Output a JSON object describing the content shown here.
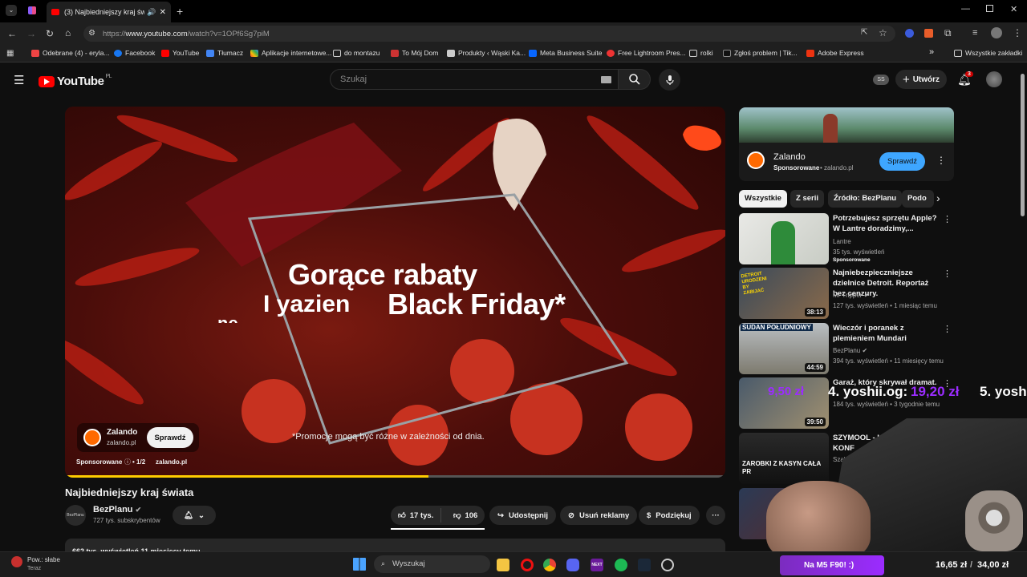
{
  "browser": {
    "tab_title": "(3) Najbiedniejszy kraj świat",
    "url_prefix": "https://",
    "url_domain": "www.youtube.com",
    "url_path": "/watch?v=1OPf6Sg7piM",
    "bookmarks": [
      "Odebrane (4) - eryla...",
      "Facebook",
      "YouTube",
      "Tłumacz",
      "Aplikacje internetowe...",
      "do montazu",
      "To Mój Dom",
      "Produkty ‹ Wąski Ka...",
      "Meta Business Suite",
      "Free Lightroom Pres...",
      "rolki",
      "Zgłoś problem | Tik...",
      "Adobe Express"
    ],
    "all_bookmarks": "Wszystkie zakładki",
    "overflow": "»"
  },
  "header": {
    "logo_text": "YouTube",
    "region": "PL",
    "search_placeholder": "Szukaj",
    "create_label": "Utwórz",
    "notif_count": "3",
    "kbd_label": "SS"
  },
  "player": {
    "headline_line1": "Gorące rabaty",
    "headline_line2": "Black Friday*",
    "headline_fragment": "I yazien",
    "headline_fragment2": "ne",
    "disclaimer": "*Promocje mogą być różne w zależności od dnia.",
    "ad_brand": "Zalando",
    "ad_domain": "zalando.pl",
    "ad_cta": "Sprawdź",
    "sponsored_label": "Sponsorowane",
    "ad_counter": "• 1/2",
    "ad_link": "zalando.pl",
    "progress": 0.55
  },
  "video": {
    "title": "Najbiedniejszy kraj świata",
    "channel": "BezPlanu",
    "channel_avatar_text": "BezPlanu",
    "subscribers": "727 tys. subskrybentów",
    "likes": "17 tys.",
    "dislikes": "106",
    "share": "Udostępnij",
    "remove_ads": "Usuń reklamy",
    "thanks": "Podziękuj",
    "more": "···",
    "description_stats": "662 tys. wyświetleń  11 miesięcy temu"
  },
  "sidebar": {
    "ad": {
      "brand": "Zalando",
      "sponsored": "Sponsorowane",
      "domain": "zalando.pl",
      "cta": "Sprawdź"
    },
    "chips": [
      "Wszystkie",
      "Z serii",
      "Źródło: BezPlanu",
      "Podo"
    ],
    "recommendations": [
      {
        "title": "Potrzebujesz sprzętu Apple? W Lantre doradzimy,...",
        "channel": "Lantre",
        "meta": "35 tys. wyświetleń",
        "badge": "Sponsorowane",
        "duration": ""
      },
      {
        "title": "Najniebezpieczniejsze dzielnice Detroit. Reportaż bez cenzury.",
        "channel": "Mr Tripper",
        "meta": "127 tys. wyświetleń • 1 miesiąc temu",
        "duration": "38:13",
        "thumb_text": "DETROIT URODZENI BY ZABIJAĆ"
      },
      {
        "title": "Wieczór i poranek z plemieniem Mundari",
        "channel": "BezPlanu",
        "meta": "394 tys. wyświetleń • 11 miesięcy temu",
        "duration": "44:59",
        "thumb_text": "SUDAN POŁUDNIOWY"
      },
      {
        "title": "Garaż, który skrywał dramat.",
        "channel": "",
        "meta": "184 tys. wyświetleń • 3 tygodnie temu",
        "duration": "39:50"
      },
      {
        "title": "SZYMOOL - HAZA LUKSUS. KONF",
        "channel": "Szalony Podc",
        "meta": "",
        "duration": "",
        "thumb_text": "ZAROBKI Z KASYN CAŁA PR"
      }
    ]
  },
  "stream_overlay": {
    "donation_amount": "9,50 zł",
    "rank4": "4. yoshii.og:",
    "rank4_amount": "19,20 zł",
    "rank5": "5. yoshi",
    "banner": "Na M5 F90! :)",
    "goal_current": "16,65 zł",
    "goal_sep": "/",
    "goal_target": "34,00 zł"
  },
  "taskbar": {
    "weather_line1": "Pow.: słabe",
    "weather_line2": "Teraz",
    "search": "Wyszukaj",
    "next_label": "NEXT"
  },
  "colors": {
    "accent_red": "#ff0000",
    "zalando_orange": "#ff6900",
    "cta_blue": "#3ea6ff",
    "progress_yellow": "#ffcc00",
    "overlay_purple": "#9b2cff"
  }
}
